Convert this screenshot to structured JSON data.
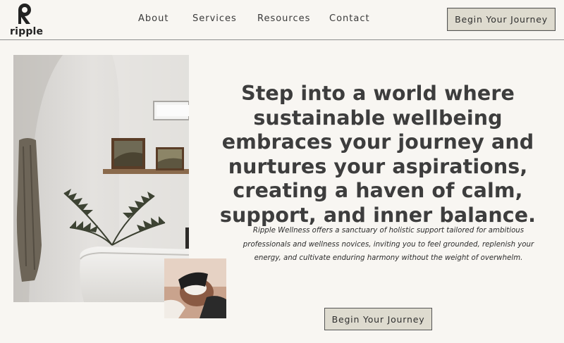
{
  "brand": {
    "name": "ripple",
    "logo_icon": "ripple-r-logo-icon"
  },
  "nav": {
    "items": [
      {
        "label": "About"
      },
      {
        "label": "Services"
      },
      {
        "label": "Resources"
      },
      {
        "label": "Contact"
      }
    ],
    "cta_label": "Begin Your Journey"
  },
  "hero": {
    "headline": "Step into a world where sustainable wellbeing embraces your journey and nurtures your aspirations, creating a haven of calm, support, and inner balance.",
    "intro": "Ripple Wellness offers a sanctuary of holistic support tailored for ambitious professionals and wellness novices, inviting you to feel grounded, replenish your energy, and cultivate enduring harmony without the weight of overwhelm.",
    "cta_label": "Begin Your Journey"
  },
  "colors": {
    "background": "#f8f6f2",
    "button_fill": "#dedbcf",
    "text": "#3d3d3d"
  }
}
